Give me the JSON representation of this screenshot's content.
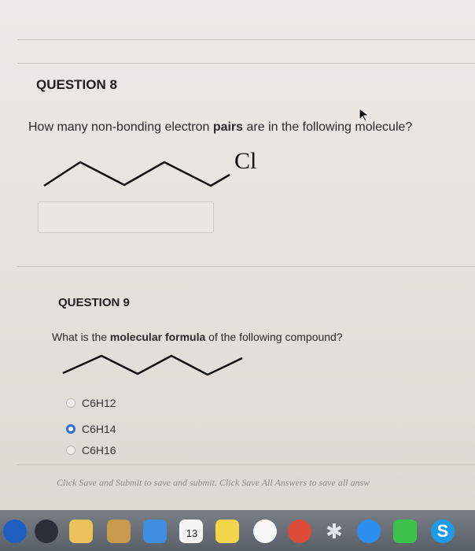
{
  "question8": {
    "title": "QUESTION 8",
    "text_before": "How many non-bonding electron ",
    "text_bold": "pairs",
    "text_after": " are in the following molecule?",
    "atom_label": "Cl",
    "answer_value": ""
  },
  "question9": {
    "title": "QUESTION 9",
    "text_before": "What is the ",
    "text_bold": "molecular formula",
    "text_after": " of the following compound?",
    "options": [
      {
        "label": "C6H12",
        "selected": false
      },
      {
        "label": "C6H14",
        "selected": true
      },
      {
        "label": "C6H16",
        "selected": false
      }
    ]
  },
  "footer": {
    "note": "Click Save and Submit to save and submit. Click Save All Answers to save all answ"
  },
  "dock": {
    "calendar_day": "13",
    "icons": [
      "launchpad-icon",
      "preview-icon",
      "photo-icon",
      "folder-icon",
      "calendar-icon",
      "notes-icon",
      "music-icon",
      "chrome-icon",
      "bluetooth-icon",
      "app-store-icon",
      "messages-icon",
      "skype-icon"
    ]
  },
  "colors": {
    "accent_radio": "#2d6fd6",
    "page_bg": "#e9e6e1"
  }
}
